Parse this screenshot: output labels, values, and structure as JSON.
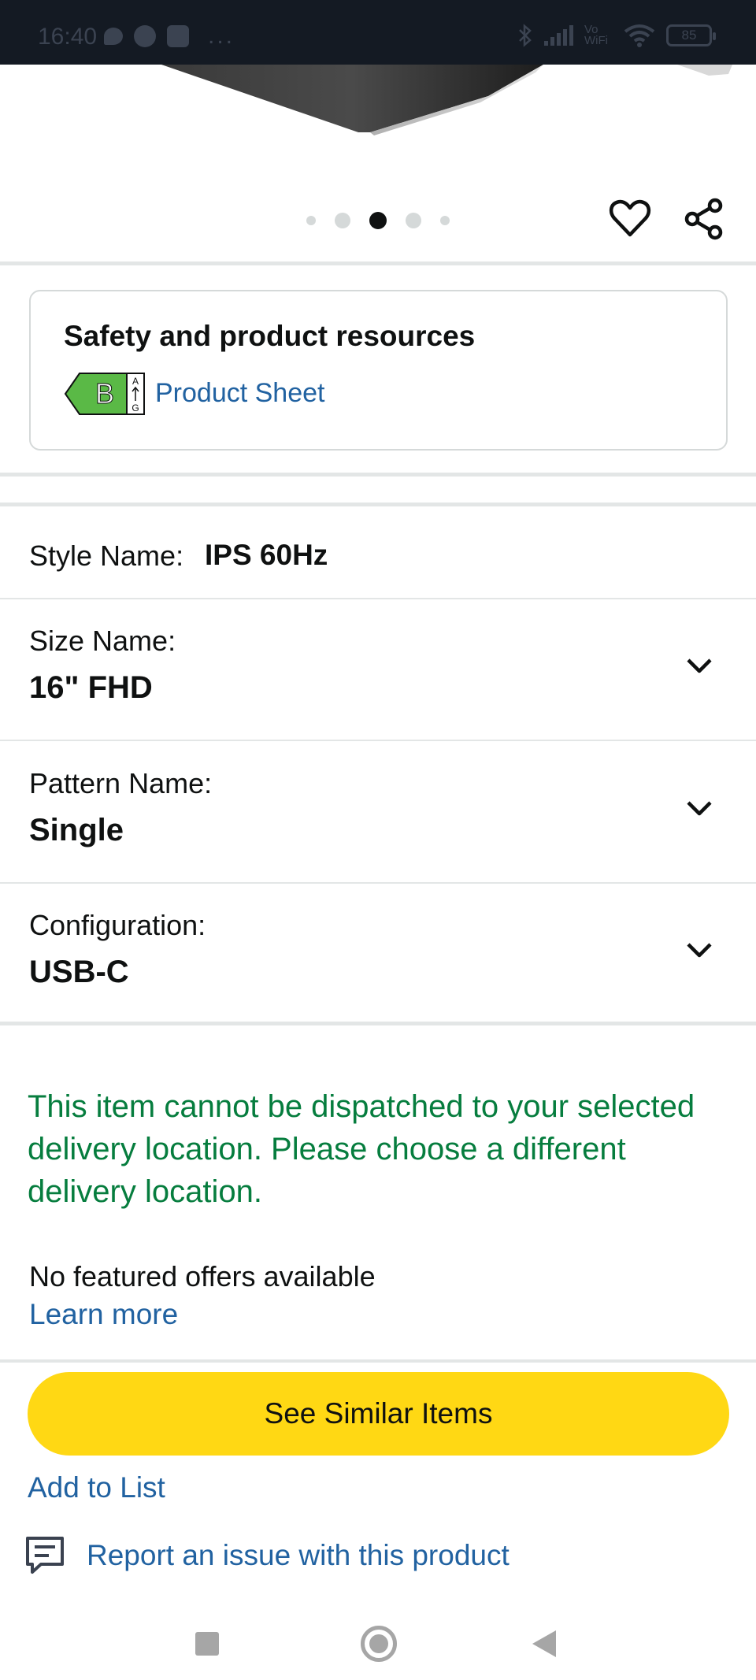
{
  "status_bar": {
    "time": "16:40",
    "more_icon": "...",
    "vowifi": "Vo WiFi",
    "battery": "85",
    "icons": [
      "chat-bubble-icon",
      "facebook-icon",
      "app-icon",
      "bluetooth-icon",
      "signal-icon",
      "wifi-icon",
      "battery-icon"
    ]
  },
  "carousel": {
    "total_images": 5,
    "active_index": 2
  },
  "actions": {
    "favorite_icon": "heart-icon",
    "share_icon": "share-icon"
  },
  "safety": {
    "title": "Safety and product resources",
    "energy_class": "B",
    "energy_scale_top": "A",
    "energy_scale_bottom": "G",
    "product_sheet_label": "Product Sheet"
  },
  "variations": {
    "style": {
      "label": "Style Name:",
      "value": "IPS 60Hz"
    },
    "size": {
      "label": "Size Name:",
      "value": "16\" FHD"
    },
    "pattern": {
      "label": "Pattern Name:",
      "value": "Single"
    },
    "configuration": {
      "label": "Configuration:",
      "value": "USB-C"
    }
  },
  "delivery": {
    "message": "This item cannot be dispatched to your selected delivery location. Please choose a different delivery location."
  },
  "offers": {
    "no_offers_text": "No featured offers available",
    "learn_more_label": "Learn more"
  },
  "buttons": {
    "see_similar_label": "See Similar Items",
    "add_to_list_label": "Add to List",
    "report_label": "Report an issue with this product"
  },
  "colors": {
    "accent_yellow": "#ffd814",
    "link_blue": "#2162a1",
    "success_green": "#067d3e",
    "energy_green": "#5ab946"
  }
}
